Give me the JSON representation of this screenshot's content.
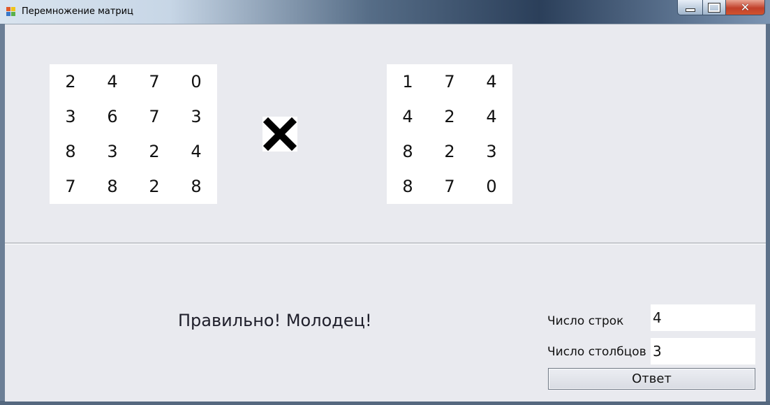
{
  "window": {
    "title": "Перемножение матриц",
    "close_glyph": "✕"
  },
  "matrix_a": {
    "rows": [
      [
        "2",
        "4",
        "7",
        "0"
      ],
      [
        "3",
        "6",
        "7",
        "3"
      ],
      [
        "8",
        "3",
        "2",
        "4"
      ],
      [
        "7",
        "8",
        "2",
        "8"
      ]
    ]
  },
  "operator": {
    "icon": "multiply-icon"
  },
  "matrix_b": {
    "rows": [
      [
        "1",
        "7",
        "4"
      ],
      [
        "4",
        "2",
        "4"
      ],
      [
        "8",
        "2",
        "3"
      ],
      [
        "8",
        "7",
        "0"
      ]
    ]
  },
  "result": {
    "message": "Правильно! Молодец!"
  },
  "controls": {
    "rows_label": "Число строк",
    "rows_value": "4",
    "cols_label": "Число столбцов",
    "cols_value": "3",
    "answer_button": "Ответ"
  }
}
